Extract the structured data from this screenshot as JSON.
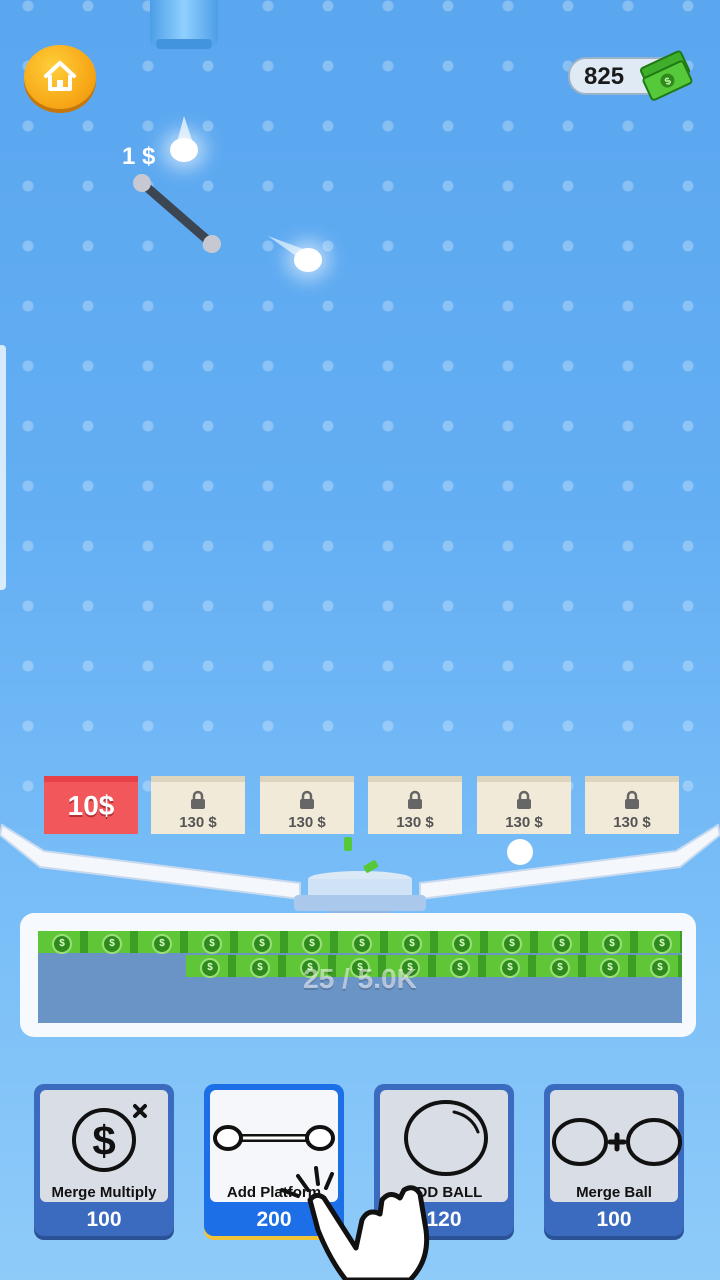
{
  "hud": {
    "coins": "825",
    "home_icon": "home-icon",
    "cash_icon": "cash-stack-icon"
  },
  "playfield": {
    "float_reward": "1 $"
  },
  "boxes": [
    {
      "price": "10$",
      "state": "unlocked"
    },
    {
      "price": "130 $",
      "state": "locked"
    },
    {
      "price": "130 $",
      "state": "locked"
    },
    {
      "price": "130 $",
      "state": "locked"
    },
    {
      "price": "130 $",
      "state": "locked"
    },
    {
      "price": "130 $",
      "state": "locked"
    }
  ],
  "collector": {
    "progress": "25 / 5.0K"
  },
  "upgrades": [
    {
      "label": "Merge Multiply",
      "cost": "100",
      "icon": "dollar-multiply-icon"
    },
    {
      "label": "Add Platform",
      "cost": "200",
      "icon": "platform-bar-icon"
    },
    {
      "label": "ADD BALL",
      "cost": "120",
      "icon": "ball-icon"
    },
    {
      "label": "Merge Ball",
      "cost": "100",
      "icon": "merge-balls-icon"
    }
  ],
  "colors": {
    "sky": "#63aef3",
    "home_button": "#f6a313",
    "unlocked_box": "#f2575c",
    "card_active": "#1c6fe6",
    "card_inactive": "#3a6bbf"
  }
}
